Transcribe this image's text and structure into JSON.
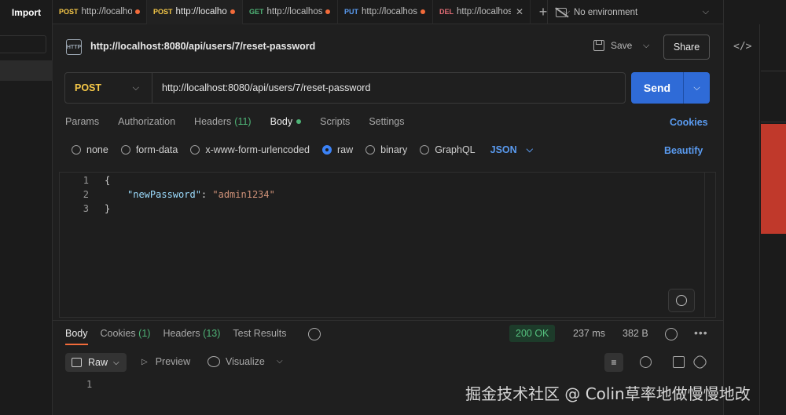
{
  "sidebar": {
    "import_label": "Import"
  },
  "tabs": [
    {
      "method": "POST",
      "method_color": "#f7c948",
      "url": "http://localho",
      "dirty": true,
      "active": false
    },
    {
      "method": "POST",
      "method_color": "#f7c948",
      "url": "http://localho",
      "dirty": true,
      "active": true
    },
    {
      "method": "GET",
      "method_color": "#4fb477",
      "url": "http://localhos",
      "dirty": true,
      "active": false
    },
    {
      "method": "PUT",
      "method_color": "#5a9bf0",
      "url": "http://localhos",
      "dirty": true,
      "active": false
    },
    {
      "method": "DEL",
      "method_color": "#e06c75",
      "url": "http://localhos",
      "dirty": false,
      "active": false
    }
  ],
  "environment": {
    "label": "No environment"
  },
  "request": {
    "icon_label": "HTTP",
    "title": "http://localhost:8080/api/users/7/reset-password",
    "save_label": "Save",
    "share_label": "Share",
    "method": "POST",
    "url": "http://localhost:8080/api/users/7/reset-password",
    "send_label": "Send",
    "tabs": {
      "params": "Params",
      "authorization": "Authorization",
      "headers": "Headers",
      "headers_count": "(11)",
      "body": "Body",
      "scripts": "Scripts",
      "settings": "Settings"
    },
    "cookies_label": "Cookies",
    "body_types": {
      "none": "none",
      "form_data": "form-data",
      "urlencoded": "x-www-form-urlencoded",
      "raw": "raw",
      "binary": "binary",
      "graphql": "GraphQL",
      "selected": "raw"
    },
    "language": "JSON",
    "beautify_label": "Beautify",
    "body_lines": {
      "n1": "1",
      "n2": "2",
      "n3": "3",
      "l1": "{",
      "key": "\"newPassword\"",
      "colon": ": ",
      "value": "\"admin1234\"",
      "l3": "}"
    }
  },
  "response": {
    "tabs": {
      "body": "Body",
      "cookies": "Cookies",
      "cookies_count": "(1)",
      "headers": "Headers",
      "headers_count": "(13)",
      "test_results": "Test Results"
    },
    "status": "200 OK",
    "time": "237 ms",
    "size": "382 B",
    "format": "Raw",
    "preview_label": "Preview",
    "visualize_label": "Visualize",
    "line_number": "1"
  },
  "watermark": "掘金技术社区 @ Colin草率地做慢慢地改",
  "colors": {
    "accent_blue": "#2f6bd7",
    "post": "#f7c948",
    "dirty_dot": "#f26b3a",
    "ok_green": "#55c27f"
  }
}
